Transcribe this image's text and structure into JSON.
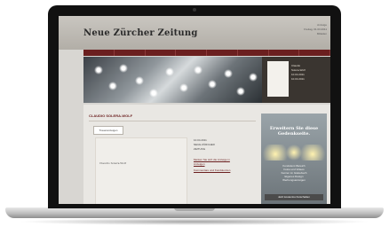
{
  "site": {
    "logo": "Neue Zürcher Zeitung",
    "header_right": [
      "Anzeige",
      "Freitag, 01.03.2011",
      "Mitteilen"
    ]
  },
  "hero_side": {
    "lines": [
      "Claudio",
      "Solera-Wolf",
      "",
      "10.04.2011",
      "",
      "10.04.2011"
    ]
  },
  "main": {
    "title": "CLAUDIO SOLERA-WOLF",
    "tab_button": "Traueranzeigen",
    "notice_name": "Claudio Solera-Wolf",
    "meta": [
      "10.04.2011",
      "NEUE ZÜRCHER",
      "ZEITUNG"
    ],
    "links": [
      "Merken Sie sich die Anzeige in",
      "Anzeigen",
      "Kommentare und Kondolenzen"
    ]
  },
  "ad": {
    "title": "Erweitern Sie diese Gedenkseite.",
    "list": [
      "Kondolenz-Bereich",
      "Fotos und Videos",
      "Kerzen im Gästebuch",
      "Eigenes Design",
      "Werbungsanzeigen"
    ],
    "button": "Jetzt kostenlos freischalten"
  },
  "colors": {
    "nav": "#6b1f1f",
    "accent": "#6b1f1f"
  }
}
